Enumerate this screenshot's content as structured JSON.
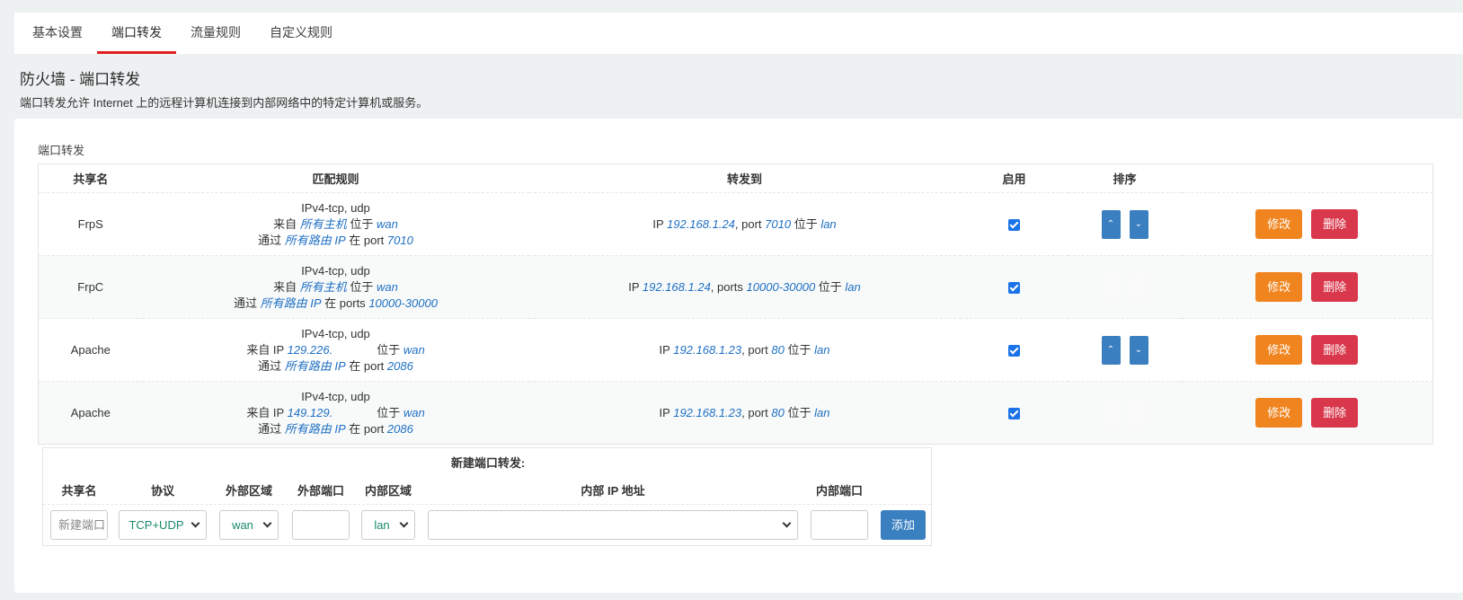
{
  "tabs": [
    "基本设置",
    "端口转发",
    "流量规则",
    "自定义规则"
  ],
  "page": {
    "title": "防火墙 - 端口转发",
    "description": "端口转发允许 Internet 上的远程计算机连接到内部网络中的特定计算机或服务。"
  },
  "section": {
    "label": "端口转发"
  },
  "table": {
    "headers": [
      "共享名",
      "匹配规则",
      "转发到",
      "启用",
      "排序"
    ],
    "rows": [
      {
        "name": "FrpS",
        "proto": "IPv4-tcp, udp",
        "from_prefix": "来自 ",
        "from_value": "所有主机",
        "from_mid": " 位于 ",
        "from_zone": "wan",
        "via_prefix": "通过 ",
        "via_value": "所有路由 IP",
        "via_mid": " 在 port ",
        "via_port": "7010",
        "fwd_ip": "192.168.1.24",
        "fwd_port_label": ", port ",
        "fwd_port": "7010",
        "fwd_mid": " 位于 ",
        "fwd_zone": "lan",
        "enabled": true,
        "sort_visible": true
      },
      {
        "name": "FrpC",
        "proto": "IPv4-tcp, udp",
        "from_prefix": "来自 ",
        "from_value": "所有主机",
        "from_mid": " 位于 ",
        "from_zone": "wan",
        "via_prefix": "通过 ",
        "via_value": "所有路由 IP",
        "via_mid": " 在 ports ",
        "via_port": "10000-30000",
        "fwd_ip": "192.168.1.24",
        "fwd_port_label": ", ports ",
        "fwd_port": "10000-30000",
        "fwd_mid": " 位于 ",
        "fwd_zone": "lan",
        "enabled": true,
        "sort_visible": false
      },
      {
        "name": "Apache",
        "proto": "IPv4-tcp, udp",
        "from_prefix": "来自 IP ",
        "from_value": "129.226.",
        "from_mid": " 位于 ",
        "from_zone": "wan",
        "via_prefix": "通过 ",
        "via_value": "所有路由 IP",
        "via_mid": " 在 port ",
        "via_port": "2086",
        "fwd_ip": "192.168.1.23",
        "fwd_port_label": ", port ",
        "fwd_port": "80",
        "fwd_mid": " 位于 ",
        "fwd_zone": "lan",
        "enabled": true,
        "sort_visible": true
      },
      {
        "name": "Apache",
        "proto": "IPv4-tcp, udp",
        "from_prefix": "来自 IP ",
        "from_value": "149.129.",
        "from_mid": " 位于 ",
        "from_zone": "wan",
        "via_prefix": "通过 ",
        "via_value": "所有路由 IP",
        "via_mid": " 在 port ",
        "via_port": "2086",
        "fwd_ip": "192.168.1.23",
        "fwd_port_label": ", port ",
        "fwd_port": "80",
        "fwd_mid": " 位于 ",
        "fwd_zone": "lan",
        "enabled": true,
        "sort_visible": false
      }
    ],
    "ip_prefix": "IP ",
    "edit_label": "修改",
    "delete_label": "删除"
  },
  "new_forward": {
    "title": "新建端口转发:",
    "headers": [
      "共享名",
      "协议",
      "外部区域",
      "外部端口",
      "内部区域",
      "内部 IP 地址",
      "内部端口"
    ],
    "name_placeholder": "新建端口",
    "protocol": "TCP+UDP",
    "ext_zone": "wan",
    "ext_port": "",
    "int_zone": "lan",
    "int_ip": "",
    "int_port": "",
    "add_label": "添加"
  },
  "colors": {
    "accent_tab": "#e02020",
    "edit": "#f0841e",
    "delete": "#d9374b",
    "primary": "#3a7fc0",
    "link": "#1e6fc2"
  }
}
